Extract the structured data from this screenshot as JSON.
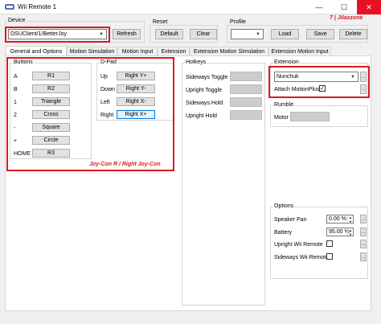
{
  "window": {
    "title": "Wii Remote 1",
    "minimize": "—",
    "maximize": "☐",
    "close": "✕"
  },
  "device": {
    "group_label": "Device",
    "selected": "DSUClient/1/BetterJoy",
    "refresh_label": "Refresh"
  },
  "reset": {
    "group_label": "Reset",
    "default_label": "Default",
    "clear_label": "Clear"
  },
  "profile": {
    "group_label": "Profile",
    "selected": "",
    "load_label": "Load",
    "save_label": "Save",
    "delete_label": "Delete"
  },
  "watermark": "7 | Jilaxzone",
  "tabs": [
    {
      "label": "General and Options"
    },
    {
      "label": "Motion Simulation"
    },
    {
      "label": "Motion Input"
    },
    {
      "label": "Extension"
    },
    {
      "label": "Extension Motion Simulation"
    },
    {
      "label": "Extension Motion Input"
    }
  ],
  "buttons_group": {
    "label": "Buttons",
    "rows": [
      {
        "name": "A",
        "value": "R1"
      },
      {
        "name": "B",
        "value": "R2"
      },
      {
        "name": "1",
        "value": "Triangle"
      },
      {
        "name": "2",
        "value": "Cross"
      },
      {
        "name": "-",
        "value": "Square"
      },
      {
        "name": "+",
        "value": "Circle"
      },
      {
        "name": "HOME",
        "value": "R3"
      }
    ]
  },
  "dpad_group": {
    "label": "D-Pad",
    "rows": [
      {
        "name": "Up",
        "value": "Right Y+"
      },
      {
        "name": "Down",
        "value": "Right Y-"
      },
      {
        "name": "Left",
        "value": "Right X-"
      },
      {
        "name": "Right",
        "value": "Right X+"
      }
    ]
  },
  "joycon_note": "Joy-Con R / Right Joy-Con",
  "hotkeys_group": {
    "label": "Hotkeys",
    "rows": [
      {
        "name": "Sideways Toggle"
      },
      {
        "name": "Upright Toggle"
      },
      {
        "name": "Sideways Hold"
      },
      {
        "name": "Upright Hold"
      }
    ]
  },
  "extension_group": {
    "label": "Extension",
    "selected": "Nunchuk",
    "motionplus_label": "Attach MotionPlus",
    "motionplus_checked": "✓"
  },
  "rumble_group": {
    "label": "Rumble",
    "motor_label": "Motor"
  },
  "options_group": {
    "label": "Options",
    "speaker_pan_label": "Speaker Pan",
    "speaker_pan_value": "0.00 %",
    "battery_label": "Battery",
    "battery_value": "95.00 %",
    "upright_label": "Upright Wii Remote",
    "sideways_label": "Sideways Wii Remote",
    "upright_checked": "",
    "sideways_checked": ""
  },
  "colors": {
    "highlight_red": "#d81b22",
    "focus_blue": "#0078d7"
  }
}
